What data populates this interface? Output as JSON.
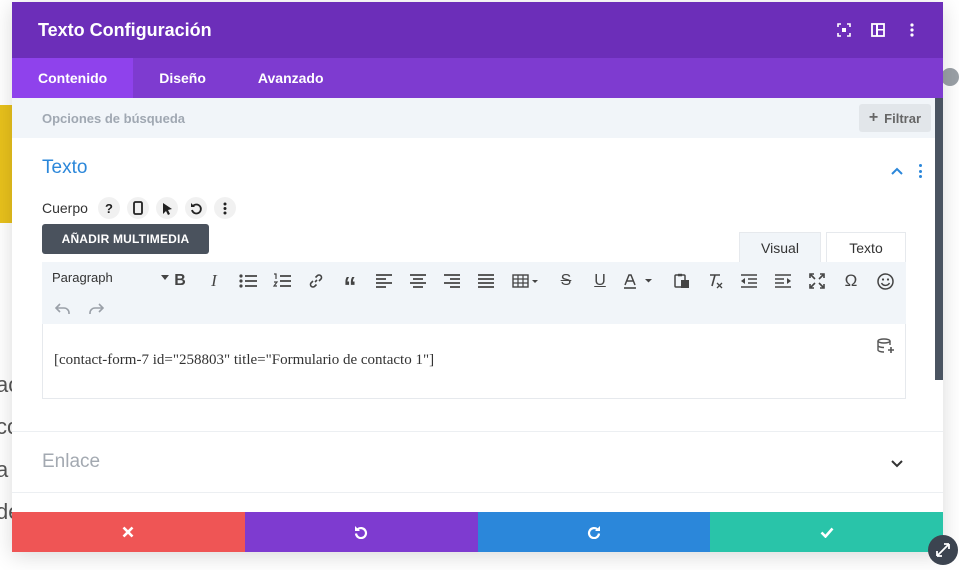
{
  "background": {
    "text_fragments": [
      "ac",
      "co",
      "a",
      "de"
    ]
  },
  "modal": {
    "title": "Texto Configuración",
    "header_icons": [
      "fullscreen-icon",
      "columns-icon",
      "more-icon"
    ],
    "tabs": [
      {
        "label": "Contenido",
        "active": true
      },
      {
        "label": "Diseño",
        "active": false
      },
      {
        "label": "Avanzado",
        "active": false
      }
    ],
    "search": {
      "placeholder": "Opciones de búsqueda",
      "filter_label": "Filtrar"
    },
    "text_section": {
      "title": "Texto",
      "body_label": "Cuerpo",
      "help_glyph": "?",
      "add_media_label": "AÑADIR MULTIMEDIA",
      "editor_tabs": [
        "Visual",
        "Texto"
      ],
      "format_select": "Paragraph",
      "content": "[contact-form-7 id=\"258803\" title=\"Formulario de contacto 1\"]"
    },
    "link_section": {
      "title": "Enlace"
    },
    "footer": {
      "cancel_color": "#ef5555",
      "undo_color": "#7e3bd0",
      "redo_color": "#2b87da",
      "save_color": "#29c4a9"
    }
  },
  "colors": {
    "header": "#6c2eb9",
    "tabs": "#7e3bd0",
    "active_tab": "#8f42ec",
    "accent_blue": "#2b87da"
  }
}
